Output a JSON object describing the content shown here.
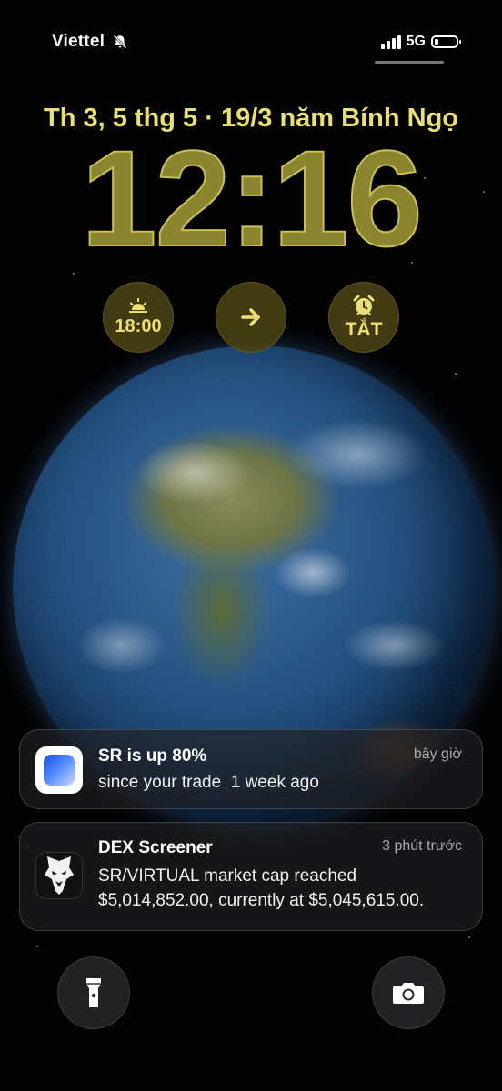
{
  "status_bar": {
    "carrier": "Viettel",
    "network": "5G",
    "icons": [
      "bell-slash-icon",
      "signal-bars-icon",
      "battery-icon"
    ]
  },
  "lock_screen": {
    "date": "Th 3, 5 thg 5 · 19/3 năm Bính Ngọ",
    "time": "12:16",
    "accent_color": "#e9df76",
    "widgets": [
      {
        "icon": "sunset-icon",
        "label": "18:00"
      },
      {
        "icon": "arrow-right-icon",
        "label": ""
      },
      {
        "icon": "alarm-clock-icon",
        "label": "TẮT"
      }
    ]
  },
  "notifications": [
    {
      "app_icon": "sr-app-icon",
      "title": "SR is up 80%",
      "time": "bây giờ",
      "body": "since your trade  1 week ago"
    },
    {
      "app_icon": "eagle-icon",
      "title": "DEX Screener",
      "time": "3 phút trước",
      "body": "SR/VIRTUAL market cap reached $5,014,852.00, currently at $5,045,615.00."
    }
  ],
  "quick_actions": {
    "left": "flashlight-icon",
    "right": "camera-icon"
  }
}
